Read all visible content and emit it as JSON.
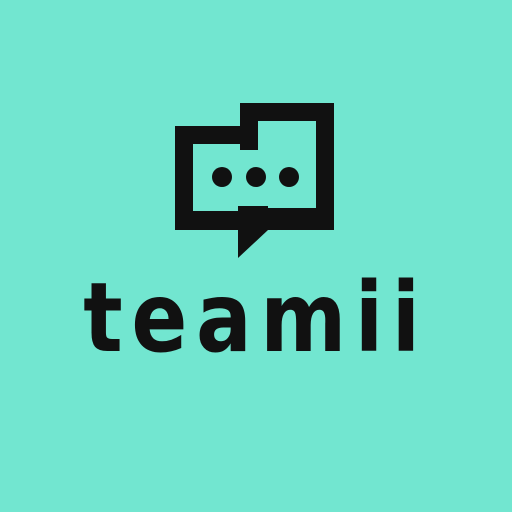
{
  "brand": {
    "name": "teamii"
  },
  "icon": {
    "name": "chat-bubble-icon"
  },
  "colors": {
    "background": "#72e6d0",
    "foreground": "#111111"
  }
}
